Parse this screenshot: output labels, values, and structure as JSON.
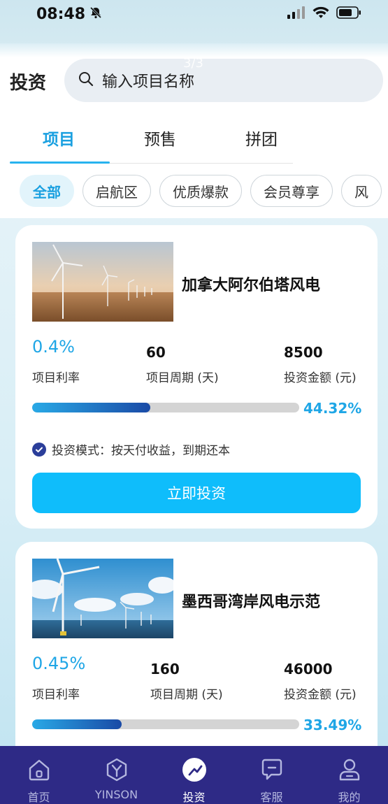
{
  "status_bar": {
    "time": "08:48"
  },
  "overlay": {
    "counter": "3/3"
  },
  "header": {
    "title": "投资",
    "search_placeholder": "输入项目名称"
  },
  "tabs": [
    {
      "label": "项目",
      "active": true
    },
    {
      "label": "预售",
      "active": false
    },
    {
      "label": "拼团",
      "active": false
    }
  ],
  "chips": [
    {
      "label": "全部",
      "active": true
    },
    {
      "label": "启航区"
    },
    {
      "label": "优质爆款"
    },
    {
      "label": "会员尊享"
    },
    {
      "label": "风"
    }
  ],
  "projects": [
    {
      "title": "加拿大阿尔伯塔风电",
      "rate": "0.4%",
      "rate_label": "项目利率",
      "period": "60",
      "period_label": "项目周期 (天)",
      "amount": "8500",
      "amount_label": "投资金额 (元)",
      "progress_percent": 44.32,
      "progress_text": "44.32%",
      "mode_text": "投资模式：按天付收益，到期还本",
      "button_label": "立即投资"
    },
    {
      "title": "墨西哥湾岸风电示范",
      "rate": "0.45%",
      "rate_label": "项目利率",
      "period": "160",
      "period_label": "项目周期 (天)",
      "amount": "46000",
      "amount_label": "投资金额 (元)",
      "progress_percent": 33.49,
      "progress_text": "33.49%"
    }
  ],
  "bottom_nav": [
    {
      "label": "首页",
      "icon": "home-icon"
    },
    {
      "label": "YINSON",
      "icon": "yinson-logo-icon"
    },
    {
      "label": "投资",
      "icon": "invest-icon",
      "active": true
    },
    {
      "label": "客服",
      "icon": "chat-icon"
    },
    {
      "label": "我的",
      "icon": "user-icon"
    }
  ],
  "colors": {
    "accent": "#1fa6e6",
    "button": "#0fbdfb",
    "nav_bg": "#2e2a86",
    "progress_start": "#29a9e6",
    "progress_end": "#1a4aa6"
  }
}
